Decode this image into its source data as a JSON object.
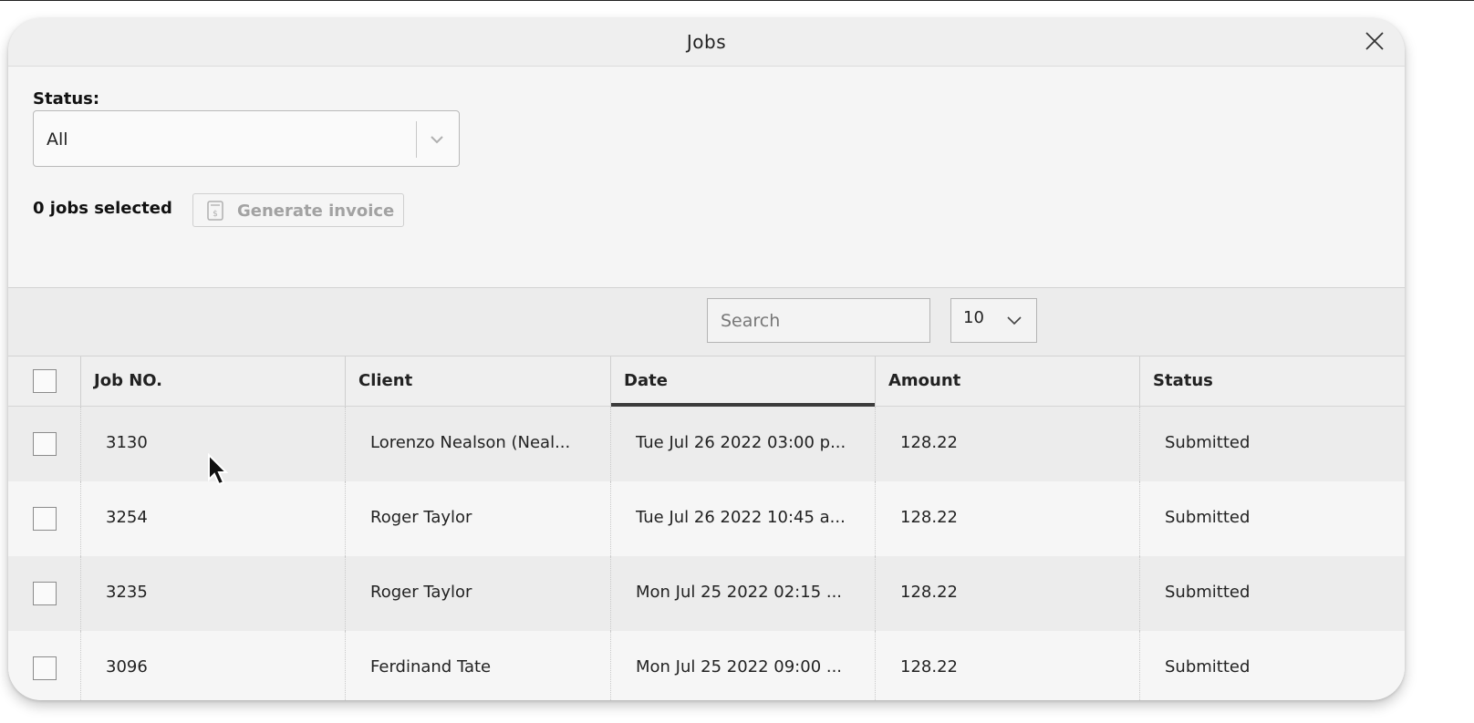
{
  "dialog": {
    "title": "Jobs",
    "close_icon": "close-icon"
  },
  "filter": {
    "status_label": "Status:",
    "status_value": "All"
  },
  "selection": {
    "count_text": "0 jobs selected",
    "generate_invoice_label": "Generate invoice",
    "generate_invoice_icon": "invoice-icon",
    "generate_invoice_enabled": false
  },
  "toolbar": {
    "search_placeholder": "Search",
    "search_value": "",
    "page_size": "10"
  },
  "table": {
    "columns": [
      "Job NO.",
      "Client",
      "Date",
      "Amount",
      "Status"
    ],
    "sorted_column": "Date",
    "rows": [
      {
        "job_no": "3130",
        "client": "Lorenzo Nealson (Neal...",
        "date": "Tue Jul 26 2022 03:00 p...",
        "amount": "128.22",
        "status": "Submitted",
        "checked": false
      },
      {
        "job_no": "3254",
        "client": "Roger Taylor",
        "date": "Tue Jul 26 2022 10:45 a...",
        "amount": "128.22",
        "status": "Submitted",
        "checked": false
      },
      {
        "job_no": "3235",
        "client": "Roger Taylor",
        "date": "Mon Jul 25 2022 02:15 ...",
        "amount": "128.22",
        "status": "Submitted",
        "checked": false
      },
      {
        "job_no": "3096",
        "client": "Ferdinand Tate",
        "date": "Mon Jul 25 2022 09:00 ...",
        "amount": "128.22",
        "status": "Submitted",
        "checked": false
      }
    ]
  },
  "colors": {
    "sort_indicator": "#3b3b3b",
    "disabled_text": "#a2a2a2"
  }
}
